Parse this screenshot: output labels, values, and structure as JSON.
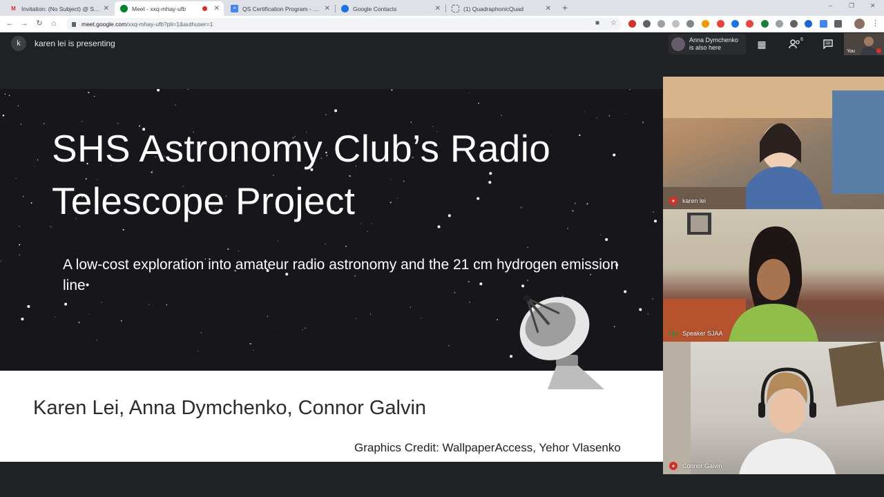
{
  "browser": {
    "tabs": [
      {
        "title": "Invitation: (No Subject) @ Sat M...",
        "favicon": "gmail-icon",
        "active": false
      },
      {
        "title": "Meet - xxq-mhay-ufb",
        "favicon": "meet-icon",
        "active": true,
        "recording": true
      },
      {
        "title": "QS Certification Program - Goog...",
        "favicon": "google-docs-icon",
        "active": false
      },
      {
        "title": "Google Contacts",
        "favicon": "contacts-icon",
        "active": false
      },
      {
        "title": "(1) QuadraphonicQuad",
        "favicon": "loading-icon",
        "active": false
      }
    ],
    "close_glyph": "✕",
    "new_tab_glyph": "+",
    "window_buttons": [
      "–",
      "❐",
      "✕"
    ],
    "url": "meet.google.com",
    "url_rest": "/xxq-mhay-ufb?pli=1&authuser=1"
  },
  "meet": {
    "presenter_initial": "k",
    "presenting_text": "karen lei is presenting",
    "also_here": {
      "name": "Anna Dymchenko",
      "status": "is also here"
    },
    "participant_count": "6",
    "self_label": "You",
    "participants": [
      {
        "name": "karen lei",
        "mic": "muted"
      },
      {
        "name": "Speaker SJAA",
        "mic": "speaking"
      },
      {
        "name": "Connor Galvin",
        "mic": "muted"
      }
    ]
  },
  "slide": {
    "title_line1": "SHS Astronomy Club’s Radio",
    "title_line2": "Telescope Project",
    "subtitle": "A low-cost exploration into amateur radio astronomy and the 21 cm hydrogen emission line",
    "authors": "Karen Lei, Anna Dymchenko, Connor Galvin",
    "credit": "Graphics Credit: WallpaperAccess, Yehor Vlasenko"
  },
  "colors": {
    "meet_bg": "#202124",
    "slide_bg": "#161519",
    "muted_red": "#d93025",
    "speaking_green": "#1e8e3e"
  }
}
